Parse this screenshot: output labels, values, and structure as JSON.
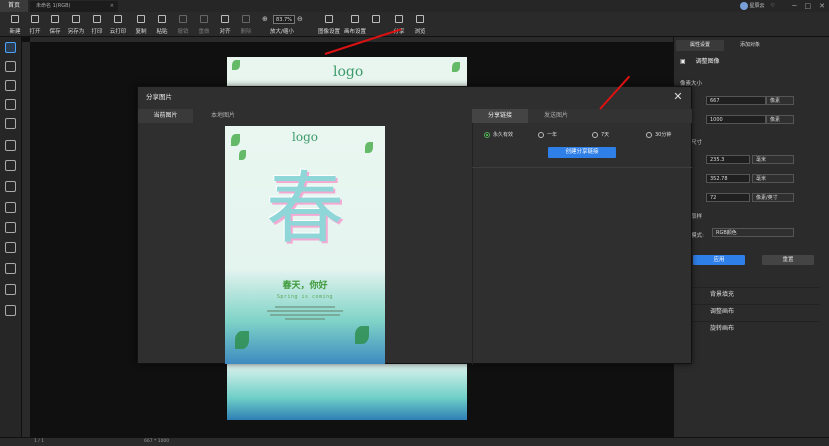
{
  "titlebar": {
    "home_tab": "首页",
    "doc_tab": "未命名 1(RGB)",
    "user": "星辰云"
  },
  "toolbar": {
    "items": [
      "新建",
      "打开",
      "保存",
      "另存为",
      "打印",
      "云打印",
      "复制",
      "粘贴",
      "撤销",
      "重做",
      "对齐",
      "删除"
    ],
    "zoom_value": "83.7%",
    "zoom_label": "放大/缩小",
    "image_settings": "图像设置",
    "canvas_settings": "画布设置",
    "share": "分享",
    "browse": "浏览"
  },
  "right_panel": {
    "tabs": [
      "属性设置",
      "添加对象"
    ],
    "adjust_image": "调整图像",
    "pixel_size": "像素大小",
    "width_px": "667",
    "height_px": "1000",
    "px_unit": "像素",
    "print_size": "打印尺寸",
    "width_mm": "235.3",
    "height_mm": "352.78",
    "mm_unit": "毫米",
    "resolution": "72",
    "res_unit": "像素/英寸",
    "resample": "重新取样",
    "color_mode_label": "颜色模式:",
    "color_mode": "RGB颜色",
    "apply": "应用",
    "reset": "重置",
    "sections": [
      "背景填充",
      "调整画布",
      "旋转画布"
    ]
  },
  "dialog": {
    "title": "分享图片",
    "left_tabs": [
      "当前图片",
      "本地图片"
    ],
    "right_tabs": [
      "分享链接",
      "发送图片"
    ],
    "expiry_options": [
      {
        "label": "永久有效",
        "checked": true
      },
      {
        "label": "一年",
        "checked": false
      },
      {
        "label": "7天",
        "checked": false
      },
      {
        "label": "30分钟",
        "checked": false
      }
    ],
    "create_link": "创建分享链接"
  },
  "preview": {
    "logo": "logo",
    "char": "春",
    "title": "春天，你好",
    "subtitle": "Spring is coming"
  },
  "canvas": {
    "logo": "logo"
  },
  "statusbar": {
    "left": "1 / 1",
    "right": "667 * 1000"
  }
}
